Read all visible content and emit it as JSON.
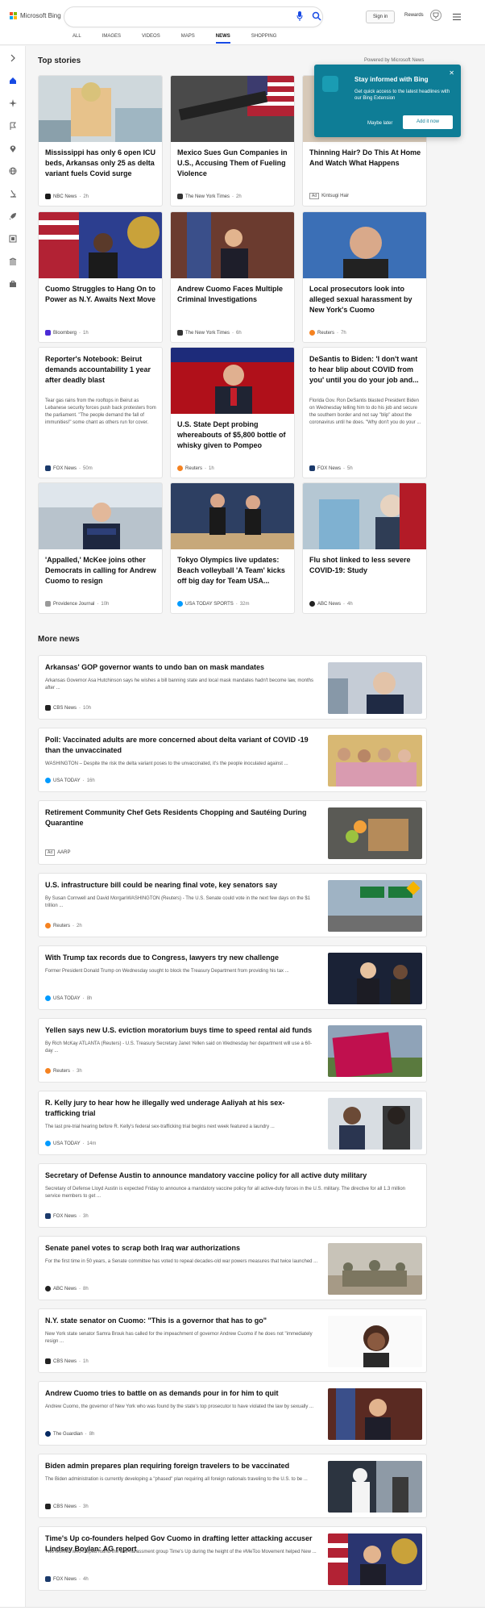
{
  "header": {
    "logo_text": "Microsoft Bing",
    "search_value": "",
    "signin_label": "Sign in",
    "rewards_label": "Rewards"
  },
  "tabs": [
    {
      "label": "ALL"
    },
    {
      "label": "IMAGES"
    },
    {
      "label": "VIDEOS"
    },
    {
      "label": "MAPS"
    },
    {
      "label": "NEWS",
      "active": true
    },
    {
      "label": "SHOPPING"
    }
  ],
  "top_stories": {
    "title": "Top stories",
    "powered_by": "Powered by Microsoft News",
    "cards": [
      {
        "title": "Mississippi has only 6 open ICU beds, Arkansas only 25 as delta variant fuels Covid surge",
        "source": "NBC News",
        "time": "2h"
      },
      {
        "title": "Mexico Sues Gun Companies in U.S., Accusing Them of Fueling Violence",
        "source": "The New York Times",
        "time": "2h"
      },
      {
        "title": "Thinning Hair? Do This At Home And Watch What Happens",
        "source": "Kintsugi Hair",
        "time": "",
        "ad": "Ad"
      },
      {
        "title": "Cuomo Struggles to Hang On to Power as N.Y. Awaits Next Move",
        "source": "Bloomberg",
        "time": "1h"
      },
      {
        "title": "Andrew Cuomo Faces Multiple Criminal Investigations",
        "source": "The New York Times",
        "time": "6h"
      },
      {
        "title": "Local prosecutors look into alleged sexual harassment by New York's Cuomo",
        "source": "Reuters",
        "time": "7h"
      },
      {
        "title": "Reporter's Notebook: Beirut demands accountability 1 year after deadly blast",
        "snippet": "Tear gas rains from the rooftops in Beirut as Lebanese security forces push back protesters from the parliament. \"The people demand the fall of immunities!\" some chant as others run for cover.",
        "source": "FOX News",
        "time": "50m"
      },
      {
        "title": "U.S. State Dept probing whereabouts of $5,800 bottle of whisky given to Pompeo",
        "source": "Reuters",
        "time": "1h"
      },
      {
        "title": "DeSantis to Biden: 'I don't want to hear blip about COVID from you' until you do your job and...",
        "snippet": "Florida Gov. Ron DeSantis blasted President Biden on Wednesday telling him to do his job and secure the southern border and not say \"blip\" about the coronavirus until he does. \"Why don't you do your ...",
        "source": "FOX News",
        "time": "5h"
      },
      {
        "title": "'Appalled,' McKee joins other Democrats in calling for Andrew Cuomo to resign",
        "source": "Providence Journal",
        "time": "10h"
      },
      {
        "title": "Tokyo Olympics live updates: Beach volleyball 'A Team' kicks off big day for Team USA...",
        "source": "USA TODAY SPORTS",
        "time": "32m"
      },
      {
        "title": "Flu shot linked to less severe COVID-19: Study",
        "source": "ABC News",
        "time": "4h"
      }
    ]
  },
  "popup": {
    "title": "Stay informed with Bing",
    "body": "Get quick access to the latest headlines with our Bing Extension",
    "later_label": "Maybe later",
    "add_label": "Add it now",
    "close_label": "✕"
  },
  "more_news": {
    "title": "More news",
    "items": [
      {
        "title": "Arkansas' GOP governor wants to undo ban on mask mandates",
        "snippet": "Arkansas Governor Asa Hutchinson says he wishes a bill banning state and local mask mandates hadn't become law, months after ...",
        "source": "CBS News",
        "time": "10h"
      },
      {
        "title": "Poll: Vaccinated adults are more concerned about delta variant of COVID -19 than the unvaccinated",
        "snippet": "WASHINGTON – Despite the risk the delta variant poses to the unvaccinated, it's the people inoculated against ...",
        "source": "USA TODAY",
        "time": "16h"
      },
      {
        "title": "Retirement Community Chef Gets Residents Chopping and Sautéing During Quarantine",
        "snippet": "",
        "source": "AARP",
        "time": "",
        "ad": "Ad"
      },
      {
        "title": "U.S. infrastructure bill could be nearing final vote, key senators say",
        "snippet": "By Susan Cornwell and David MorganWASHINGTON (Reuters) - The U.S. Senate could vote in the next few days on the $1 trillion ...",
        "source": "Reuters",
        "time": "2h"
      },
      {
        "title": "With Trump tax records due to Congress, lawyers try new challenge",
        "snippet": "Former President Donald Trump on Wednesday sought to block the Treasury Department from providing his tax ...",
        "source": "USA TODAY",
        "time": "8h"
      },
      {
        "title": "Yellen says new U.S. eviction moratorium buys time to speed rental aid funds",
        "snippet": "By Rich McKay ATLANTA (Reuters) - U.S. Treasury Secretary Janet Yellen said on Wednesday her department will use a 60-day ...",
        "source": "Reuters",
        "time": "3h"
      },
      {
        "title": "R. Kelly jury to hear how he illegally wed underage Aaliyah at his sex-trafficking trial",
        "snippet": "The last pre-trial hearing before R. Kelly's federal sex-trafficking trial begins next week featured a laundry ...",
        "source": "USA TODAY",
        "time": "14m"
      },
      {
        "title": "Secretary of Defense Austin to announce mandatory vaccine policy for all active duty military",
        "snippet": "Secretary of Defense Lloyd Austin is expected Friday to announce a mandatory vaccine policy for all active-duty forces in the U.S. military. The directive for all 1.3 million service members to get ...",
        "source": "FOX News",
        "time": "3h"
      },
      {
        "title": "Senate panel votes to scrap both Iraq war authorizations",
        "snippet": "For the first time in 50 years, a Senate committee has voted to repeal decades-old war powers measures that twice launched ...",
        "source": "ABC News",
        "time": "8h"
      },
      {
        "title": "N.Y. state senator on Cuomo: \"This is a governor that has to go\"",
        "snippet": "New York state senator Samra Brouk has called for the impeachment of governor Andrew Cuomo if he does not \"immediately resign ...",
        "source": "CBS News",
        "time": "1h"
      },
      {
        "title": "Andrew Cuomo tries to battle on as demands pour in for him to quit",
        "snippet": "Andrew Cuomo, the governor of New York who was found by the state's top prosecutor to have violated the law by sexually ...",
        "source": "The Guardian",
        "time": "8h"
      },
      {
        "title": "Biden admin prepares plan requiring foreign travelers to be vaccinated",
        "snippet": "The Biden administration is currently developing a \"phased\" plan requiring all foreign nationals traveling to the U.S. to be ...",
        "source": "CBS News",
        "time": "3h"
      },
      {
        "title": "Time's Up co-founders helped Gov Cuomo in drafting letter attacking accuser Lindsey Boylan: AG report",
        "snippet": "Two women who helped found the anti-harassment group Time's Up during the height of the #MeToo Movement helped New ...",
        "source": "FOX News",
        "time": "4h"
      }
    ]
  },
  "colors": {
    "accent": "#174ae4",
    "popup_bg": "#0e7d96"
  }
}
